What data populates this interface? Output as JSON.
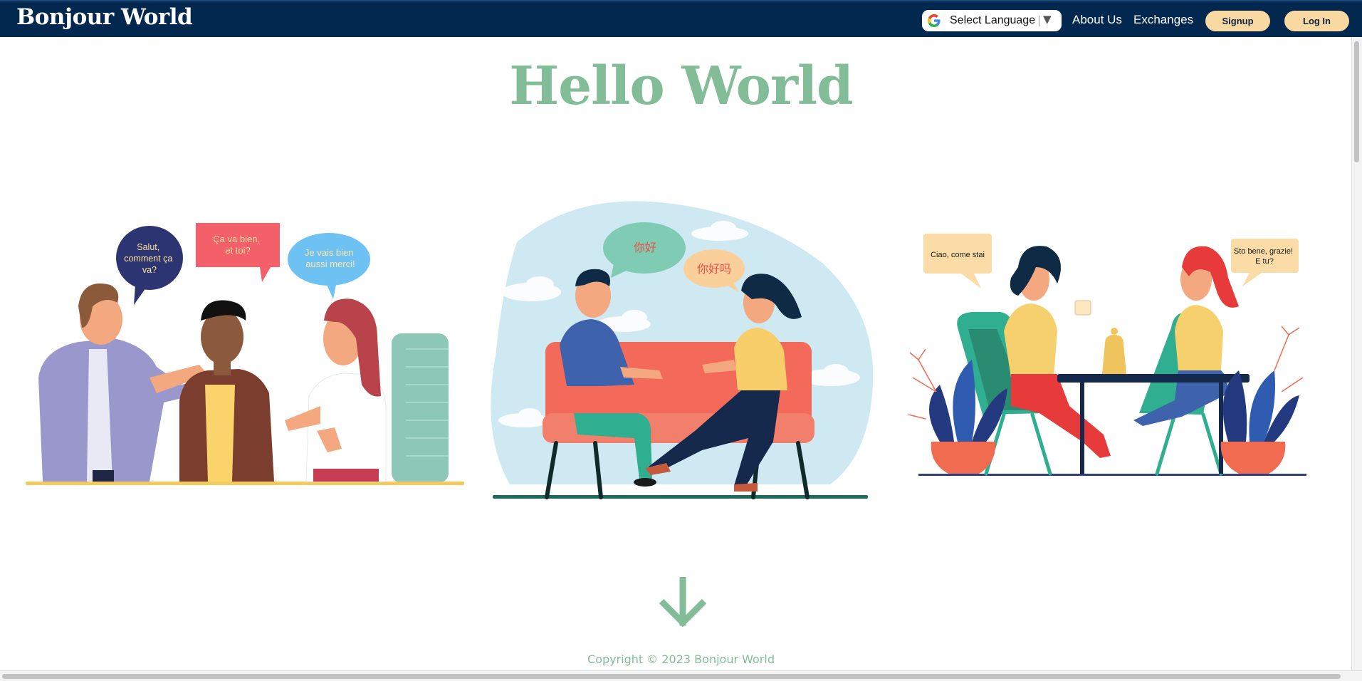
{
  "navbar": {
    "brand": "Bonjour World",
    "language_select": {
      "label": "Select Language",
      "arrow": "▼",
      "icon": "google-g-icon"
    },
    "links": {
      "about": "About Us",
      "exchanges": "Exchanges"
    },
    "buttons": {
      "signup": "Signup",
      "login": "Log In"
    }
  },
  "hero": {
    "title": "Hello World"
  },
  "illustrations": {
    "french": {
      "bubble_1": [
        "Salut,",
        "comment ça",
        "va?"
      ],
      "bubble_2": [
        "Ça va bien,",
        "et toi?"
      ],
      "bubble_3": [
        "Je vais bien",
        "aussi merci!"
      ]
    },
    "chinese": {
      "bubble_1": "你好",
      "bubble_2": "你好吗"
    },
    "italian": {
      "bubble_1": "Ciao, come stai",
      "bubble_2": [
        "Sto bene, grazie!",
        "E tu?"
      ]
    }
  },
  "scroll_down": {
    "icon": "arrow-down-icon"
  },
  "footer": {
    "copyright": "Copyright © 2023 Bonjour World"
  },
  "colors": {
    "navbar_bg": "#03284f",
    "accent_green": "#83bd97",
    "button_bg": "#fad8a2"
  }
}
